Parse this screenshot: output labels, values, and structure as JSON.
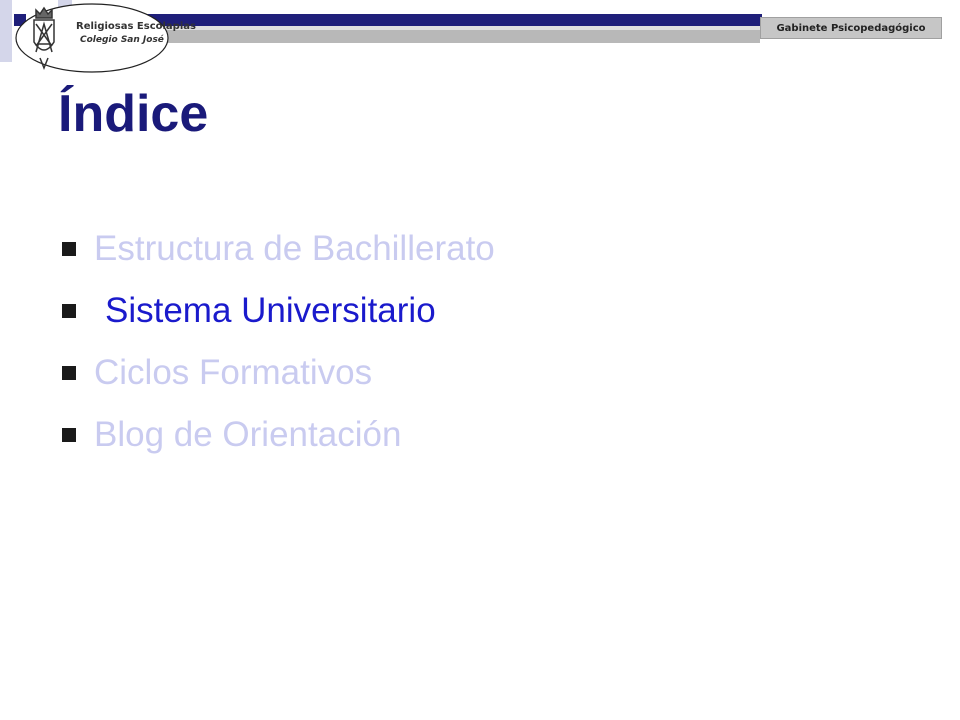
{
  "header": {
    "logo_line1": "Religiosas Escolapias",
    "logo_line2": "Colegio San José",
    "department": "Gabinete Psicopedagógico"
  },
  "slide": {
    "title": "Índice",
    "items": [
      {
        "label": "Estructura de Bachillerato",
        "state": "dimmed"
      },
      {
        "label": "Sistema Universitario",
        "state": "active"
      },
      {
        "label": "Ciclos Formativos",
        "state": "dimmed"
      },
      {
        "label": "Blog de Orientación",
        "state": "dimmed"
      }
    ]
  },
  "colors": {
    "title": "#1a1a7a",
    "active_item": "#1a1acc",
    "dimmed_item": "#c9cbf0",
    "header_bar": "#1f1f7a"
  }
}
